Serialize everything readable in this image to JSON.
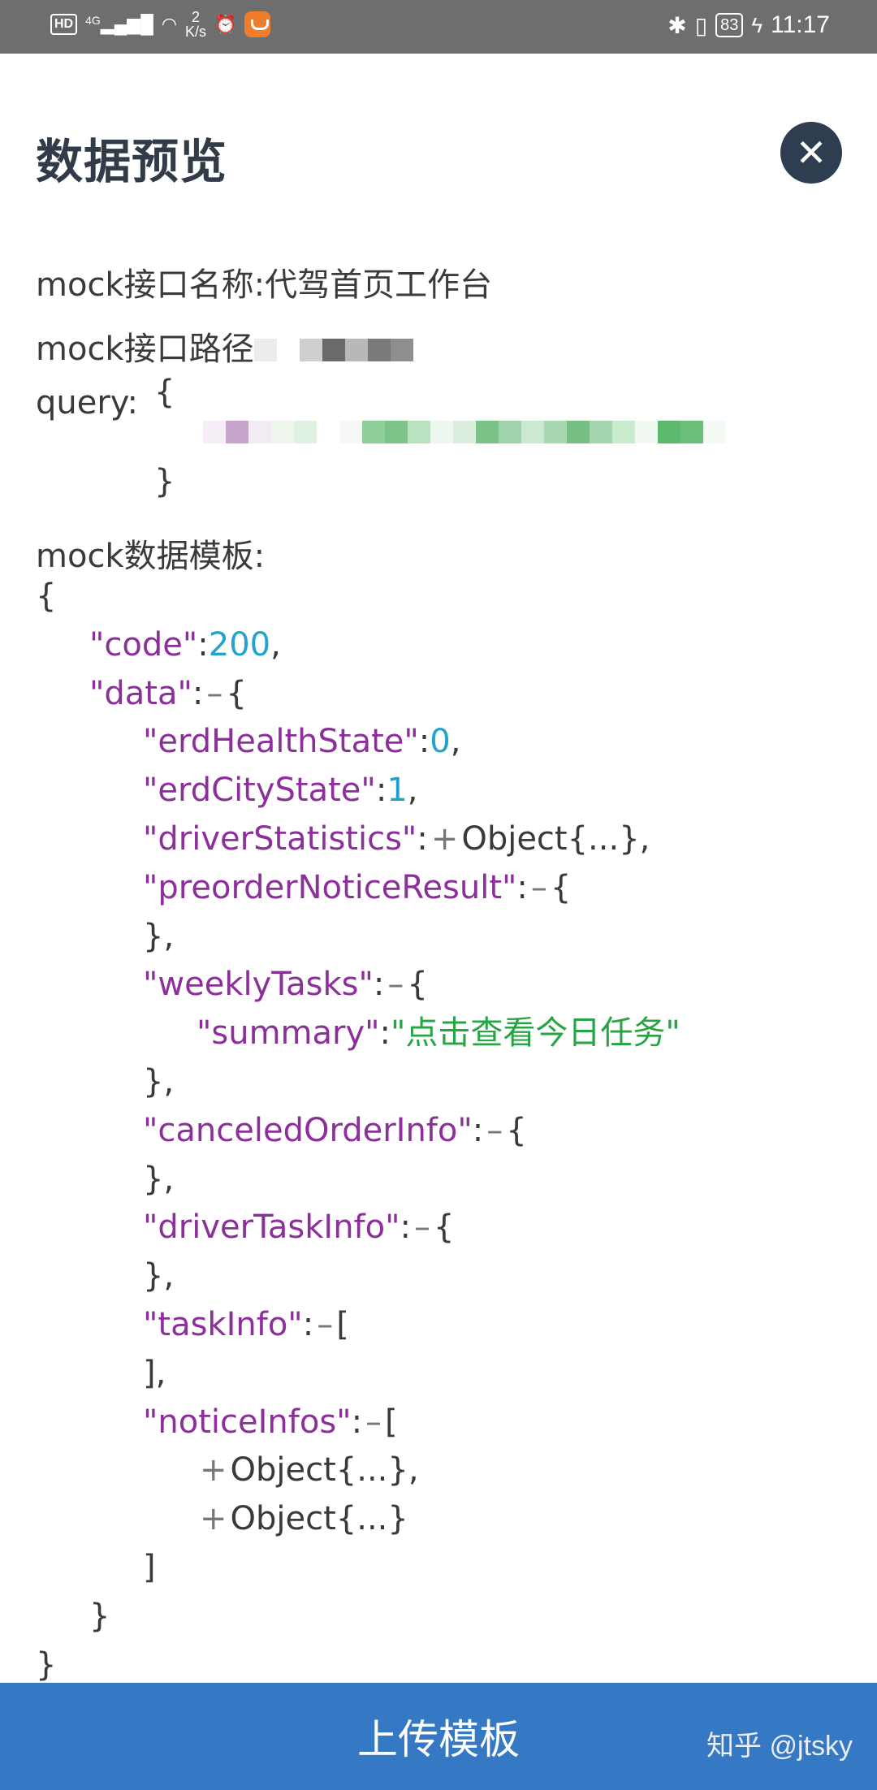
{
  "status_bar": {
    "hd": "HD",
    "net": "4G",
    "speed_value": "2",
    "speed_unit": "K/s",
    "battery": "83",
    "time": "11:17"
  },
  "header": {
    "title": "数据预览",
    "close_glyph": "✕"
  },
  "info": {
    "name_line": "mock接口名称:代驾首页工作台",
    "path_label": "mock接口路径",
    "query_label": "query:"
  },
  "template_label": "mock数据模板:",
  "json_preview": {
    "open_brace": "{",
    "code_key": "\"code\"",
    "code_val": "200",
    "data_key": "\"data\"",
    "erdHealthState_key": "\"erdHealthState\"",
    "erdHealthState_val": "0",
    "erdCityState_key": "\"erdCityState\"",
    "erdCityState_val": "1",
    "driverStatistics_key": "\"driverStatistics\"",
    "collapsed_object": "Object{...}",
    "preorderNoticeResult_key": "\"preorderNoticeResult\"",
    "weeklyTasks_key": "\"weeklyTasks\"",
    "summary_key": "\"summary\"",
    "summary_val": "\"点击查看今日任务\"",
    "canceledOrderInfo_key": "\"canceledOrderInfo\"",
    "driverTaskInfo_key": "\"driverTaskInfo\"",
    "taskInfo_key": "\"taskInfo\"",
    "noticeInfos_key": "\"noticeInfos\"",
    "close_brace": "}"
  },
  "footer": {
    "upload_label": "上传模板",
    "watermark": "知乎 @jtsky"
  },
  "colors": {
    "key": "#8c2f9b",
    "number": "#21a3cc",
    "string": "#27a443",
    "button": "#3578c4",
    "close_button": "#2e3e50"
  }
}
